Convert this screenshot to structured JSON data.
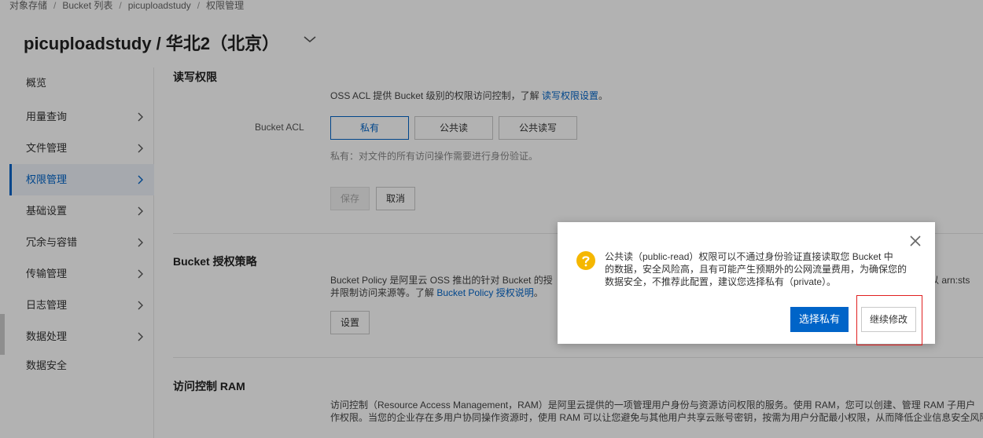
{
  "breadcrumb": [
    "对象存储",
    "Bucket 列表",
    "picuploadstudy",
    "权限管理"
  ],
  "page_title": "picuploadstudy / 华北2（北京）",
  "sidebar": {
    "items": [
      {
        "label": "概览",
        "chevron": false
      },
      {
        "label": "用量查询",
        "chevron": true
      },
      {
        "label": "文件管理",
        "chevron": true
      },
      {
        "label": "权限管理",
        "chevron": true,
        "active": true
      },
      {
        "label": "基础设置",
        "chevron": true
      },
      {
        "label": "冗余与容错",
        "chevron": true
      },
      {
        "label": "传输管理",
        "chevron": true
      },
      {
        "label": "日志管理",
        "chevron": true
      },
      {
        "label": "数据处理",
        "chevron": true
      },
      {
        "label": "数据安全",
        "chevron": false
      }
    ]
  },
  "acl": {
    "title": "读写权限",
    "desc": "OSS ACL 提供 Bucket 级别的权限访问控制，了解",
    "link": "读写权限设置",
    "label": "Bucket ACL",
    "options": [
      "私有",
      "公共读",
      "公共读写"
    ],
    "hint": "私有：对文件的所有访问操作需要进行身份验证。",
    "save": "保存",
    "cancel": "取消"
  },
  "policy": {
    "title": "Bucket 授权策略",
    "desc_line1": "Bucket Policy 是阿里云 OSS 推出的针对 Bucket 的授",
    "desc_line1_tail": "以 arn:sts",
    "desc_line2": "并限制访问来源等。了解",
    "link": "Bucket Policy 授权说明",
    "button": "设置"
  },
  "ram": {
    "title": "访问控制 RAM",
    "desc_line1": "访问控制（Resource Access Management，RAM）是阿里云提供的一项管理用户身份与资源访问权限的服务。使用 RAM，您可以创建、管理 RAM 子用户",
    "desc_line2": "作权限。当您的企业存在多用户协同操作资源时，使用 RAM 可以让您避免与其他用户共享云账号密钥，按需为用户分配最小权限，从而降低企业信息安全风险"
  },
  "dialog": {
    "line1": "公共读（public-read）权限可以不通过身份验证直接读取您 Bucket 中",
    "line2": "的数据，安全风险高，且有可能产生预期外的公网流量费用，为确保您的",
    "line3": "数据安全，不推荐此配置，建议您选择私有（private）。",
    "primary": "选择私有",
    "secondary": "继续修改"
  },
  "colors": {
    "accent": "#0064c8",
    "warning": "#f5b700",
    "highlight": "#e02020"
  }
}
